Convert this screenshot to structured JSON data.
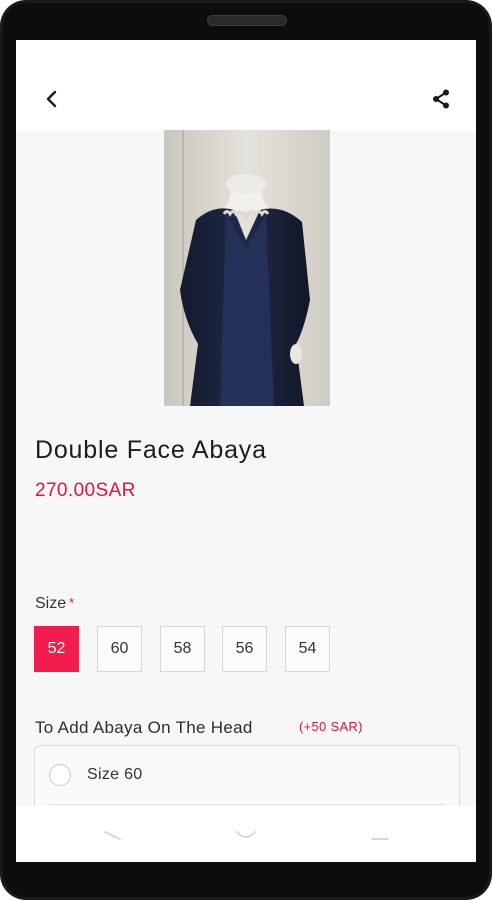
{
  "header": {
    "back_icon": "back-chevron-icon",
    "share_icon": "share-icon"
  },
  "product": {
    "image_description": "navy-abaya-on-mannequin",
    "title": "Double Face Abaya",
    "price": "270.00SAR"
  },
  "size": {
    "label": "Size",
    "required_mark": "*",
    "options": [
      "52",
      "60",
      "58",
      "56",
      "54"
    ],
    "selected": "52"
  },
  "addon": {
    "label": "To Add Abaya On The Head",
    "price": "(+50 SAR)",
    "options": [
      {
        "label": "Size 60",
        "checked": false
      }
    ]
  },
  "nav": {
    "back_icon": "nav-back-icon",
    "home_icon": "nav-home-icon",
    "recents_icon": "nav-recents-icon"
  },
  "colors": {
    "accent": "#f31d4d",
    "price": "#e8103e",
    "text": "#1c1c1c",
    "screen_bg": "#f7f7f7"
  }
}
